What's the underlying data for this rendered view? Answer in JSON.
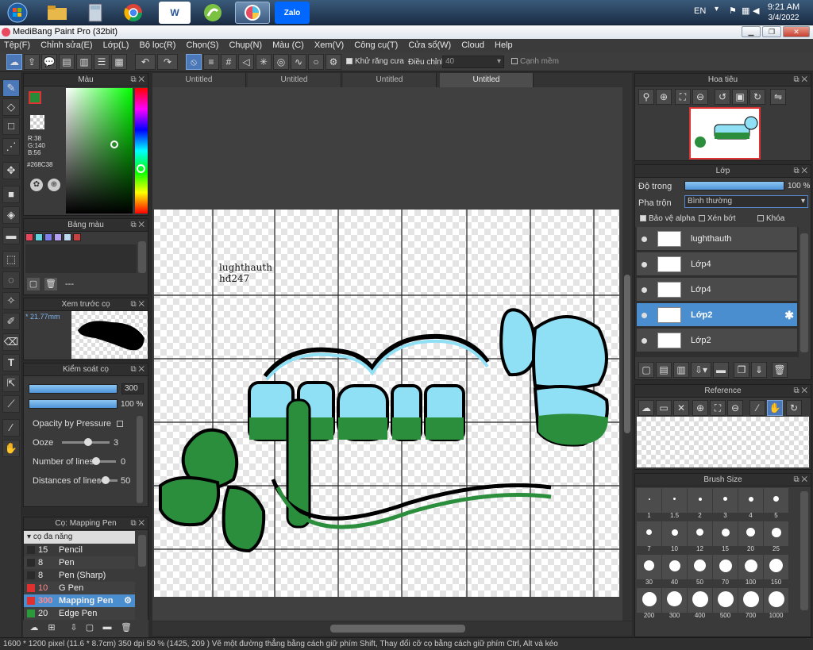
{
  "taskbar": {
    "icons": [
      "start-orb",
      "file-explorer",
      "calculator",
      "chrome",
      "word",
      "corel",
      "medibang",
      "zalo"
    ],
    "word_label": "W",
    "zalo_label": "Zalo",
    "lang": "EN",
    "time": "9:21 AM",
    "date": "3/4/2022"
  },
  "window": {
    "title": "MediBang Paint Pro (32bit)"
  },
  "menu": [
    "Tệp(F)",
    "Chỉnh sửa(E)",
    "Lớp(L)",
    "Bộ lọc(R)",
    "Chọn(S)",
    "Chụp(N)",
    "Màu (C)",
    "Xem(V)",
    "Công cụ(T)",
    "Cửa sổ(W)",
    "Cloud",
    "Help"
  ],
  "toolbar": {
    "antialias_label": "Khử răng cưa",
    "adjust_label": "Điều chỉnh",
    "adjust_value": "40",
    "edge_label": "Cạnh mềm"
  },
  "tabs": [
    "Untitled",
    "Untitled",
    "Untitled",
    "Untitled"
  ],
  "color_panel": {
    "title": "Màu",
    "r": "R:38",
    "g": "G:140",
    "b": "B:56",
    "hex": "#268C38",
    "primary": "#268C38",
    "secondary": "#47C3E8"
  },
  "palette_panel": {
    "title": "Bảng màu",
    "swatches": [
      "#e8455a",
      "#5fd3e0",
      "#7e7ef0",
      "#b59ff0",
      "#bcd8f0",
      "#c94040"
    ],
    "footer": "---"
  },
  "brush_preview": {
    "title": "Xem trước cọ",
    "size": "* 21.77mm"
  },
  "brush_control": {
    "title": "Kiểm soát cọ",
    "size_value": "300",
    "opacity_value": "100 %",
    "opacity_pressure_label": "Opacity by Pressure",
    "ooze_label": "Ooze",
    "ooze_value": "3",
    "lines_label": "Number of lines",
    "lines_value": "0",
    "distance_label": "Distances of lines",
    "distance_value": "50"
  },
  "brush_list": {
    "title": "Cọ: Mapping Pen",
    "group": "cọ đa năng",
    "items": [
      {
        "size": "15",
        "name": "Pencil",
        "color": "#2a2a2a"
      },
      {
        "size": "8",
        "name": "Pen",
        "color": "#2a2a2a"
      },
      {
        "size": "8",
        "name": "Pen (Sharp)",
        "color": "#2a2a2a"
      },
      {
        "size": "10",
        "name": "G Pen",
        "color": "#e03030"
      },
      {
        "size": "300",
        "name": "Mapping Pen",
        "color": "#e03030"
      },
      {
        "size": "20",
        "name": "Edge Pen",
        "color": "#2a9a3a"
      }
    ]
  },
  "navigator": {
    "title": "Hoa tiêu"
  },
  "layers": {
    "title": "Lớp",
    "opacity_label": "Độ trong",
    "opacity_value": "100 %",
    "blend_label": "Pha trộn",
    "blend_value": "Bình thường",
    "protect_alpha": "Bảo vệ alpha",
    "clipping": "Xén bớt",
    "lock": "Khóa",
    "items": [
      "lughthauth",
      "Lớp4",
      "Lớp4",
      "Lớp2",
      "Lớp2"
    ]
  },
  "reference": {
    "title": "Reference"
  },
  "brush_size": {
    "title": "Brush Size",
    "sizes": [
      "1",
      "1.5",
      "2",
      "3",
      "4",
      "5",
      "7",
      "10",
      "12",
      "15",
      "20",
      "25",
      "30",
      "40",
      "50",
      "70",
      "100",
      "150",
      "200",
      "300",
      "400",
      "500",
      "700",
      "1000"
    ]
  },
  "canvas_text": {
    "line1": "lughthauth",
    "line2": "hđ247"
  },
  "status": "1600 * 1200 pixel   (11.6 * 8.7cm)   350 dpi   50 %   (1425, 209 )   Vẽ một đường thẳng bằng cách giữ phím Shift, Thay đổi cỡ cọ bằng cách giữ phím Ctrl, Alt và kéo"
}
